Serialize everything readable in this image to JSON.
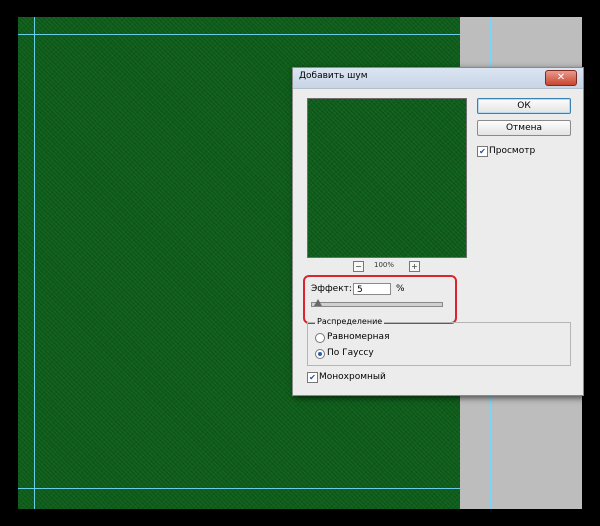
{
  "dialog": {
    "title": "Добавить шум",
    "close_glyph": "✕",
    "ok_label": "ОК",
    "cancel_label": "Отмена",
    "preview_label": "Просмотр",
    "preview_checked": true,
    "zoom_minus": "−",
    "zoom_plus": "+",
    "zoom_level": "100%",
    "effect_label": "Эффект:",
    "effect_value": "5",
    "effect_unit": "%",
    "effect_fraction": 0.05,
    "distribution_label": "Распределение",
    "distribution_options": [
      {
        "label": "Равномерная",
        "selected": false
      },
      {
        "label": "По Гауссу",
        "selected": true
      }
    ],
    "monochrome_label": "Монохромный",
    "monochrome_checked": true
  },
  "colors": {
    "canvas_green": "#0d5c19",
    "guide": "#73d9ff",
    "highlight": "#d9252b"
  }
}
